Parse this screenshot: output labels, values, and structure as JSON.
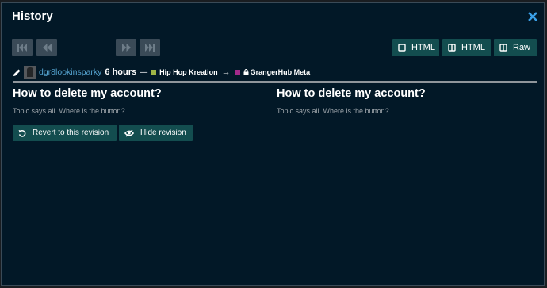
{
  "modal": {
    "title": "History",
    "close_icon": "close-icon"
  },
  "nav": {
    "first_icon": "first-revision-icon",
    "previous_icon": "previous-revision-icon",
    "next_icon": "next-revision-icon",
    "last_icon": "last-revision-icon"
  },
  "view_modes": [
    {
      "label": "HTML",
      "icon": "inline-view-icon"
    },
    {
      "label": "HTML",
      "icon": "side-by-side-icon"
    },
    {
      "label": "Raw",
      "icon": "side-by-side-raw-icon"
    }
  ],
  "revision": {
    "username": "dgr8lookinsparky",
    "age": "6 hours",
    "separator": "—",
    "from_category": "Hip Hop Kreation",
    "from_category_color": "#9fb547",
    "arrow": "→",
    "to_category": "GrangerHub Meta",
    "to_category_color": "#a22a8a"
  },
  "left": {
    "title": "How to delete my account?",
    "body": "Topic says all. Where is the button?"
  },
  "right": {
    "title": "How to delete my account?",
    "body": "Topic says all. Where is the button?"
  },
  "actions": {
    "revert_label": "Revert to this revision",
    "hide_label": "Hide revision"
  },
  "colors": {
    "background": "#021827",
    "button": "#134d4f",
    "link": "#55a4d0",
    "close": "#3aa0e8"
  }
}
